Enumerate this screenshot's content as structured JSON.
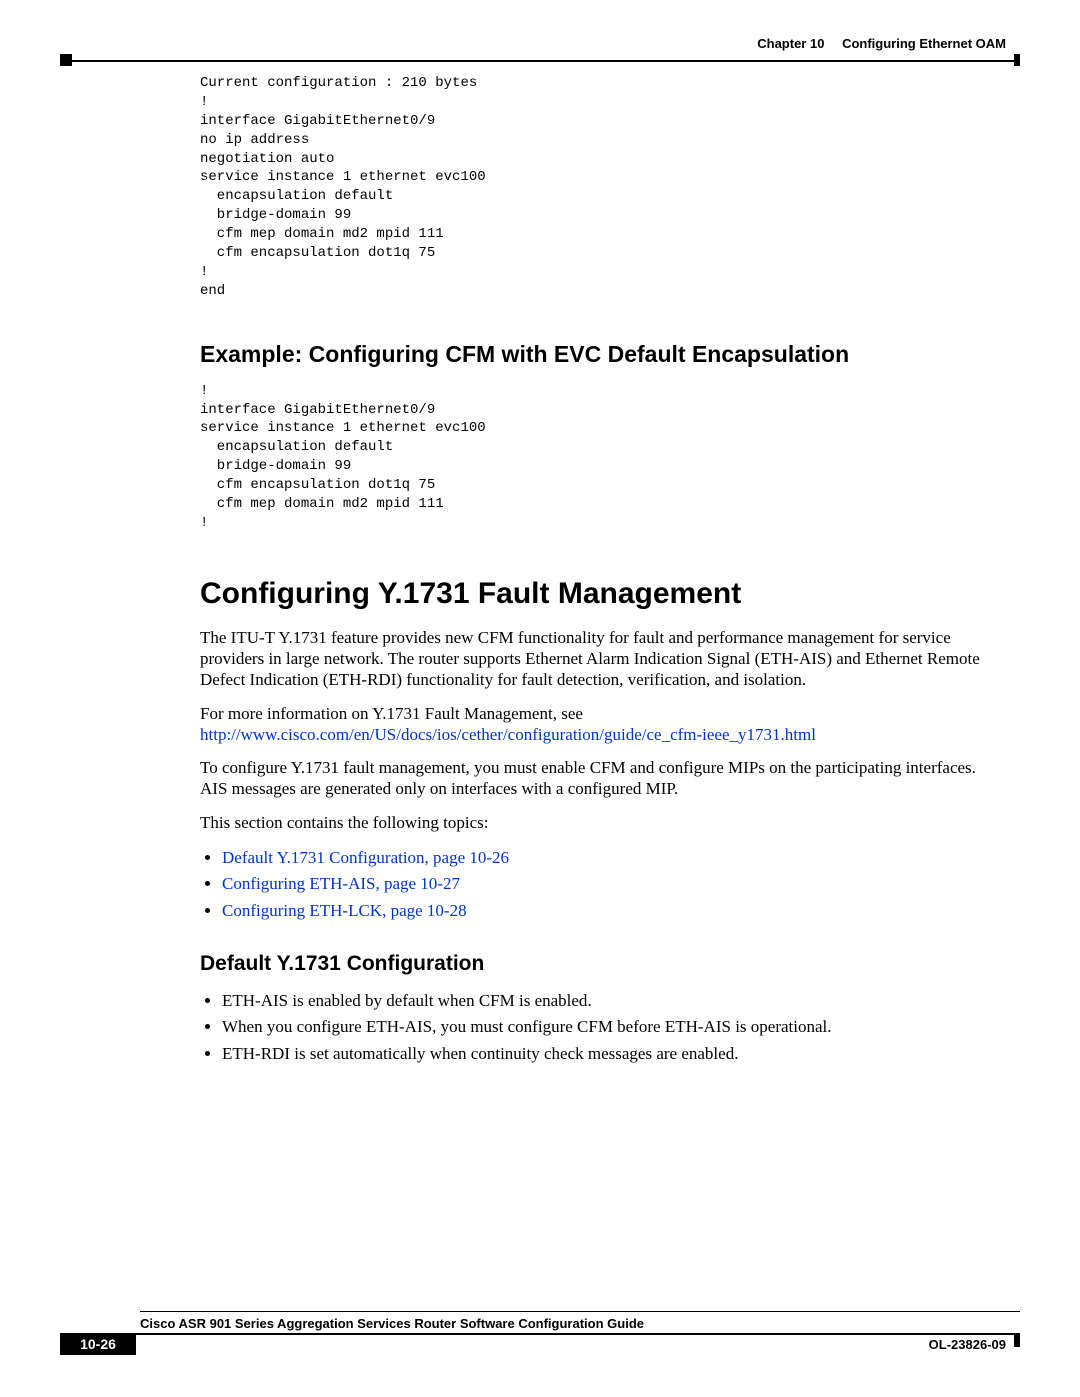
{
  "header": {
    "chapter": "Chapter 10",
    "title": "Configuring Ethernet OAM"
  },
  "code_block_1": "Current configuration : 210 bytes\n!\ninterface GigabitEthernet0/9\nno ip address\nnegotiation auto\nservice instance 1 ethernet evc100\n  encapsulation default\n  bridge-domain 99\n  cfm mep domain md2 mpid 111\n  cfm encapsulation dot1q 75\n!\nend",
  "section1_heading": "Example: Configuring CFM with EVC Default Encapsulation",
  "code_block_2": "!\ninterface GigabitEthernet0/9\nservice instance 1 ethernet evc100\n  encapsulation default\n  bridge-domain 99\n  cfm encapsulation dot1q 75\n  cfm mep domain md2 mpid 111\n!",
  "main_heading": "Configuring Y.1731 Fault Management",
  "para1": "The ITU-T Y.1731 feature provides new CFM functionality for fault and performance management for service providers in large network. The router supports Ethernet Alarm Indication Signal (ETH-AIS) and Ethernet Remote Defect Indication (ETH-RDI) functionality for fault detection, verification, and isolation.",
  "para2_lead": "For more information on Y.1731 Fault Management, see",
  "para2_link": "http://www.cisco.com/en/US/docs/ios/cether/configuration/guide/ce_cfm-ieee_y1731.html",
  "para3": "To configure Y.1731 fault management, you must enable CFM and configure MIPs on the participating interfaces. AIS messages are generated only on interfaces with a configured MIP.",
  "para4": "This section contains the following topics:",
  "topic_links": [
    "Default Y.1731 Configuration, page 10-26",
    "Configuring ETH-AIS, page 10-27",
    "Configuring ETH-LCK, page 10-28"
  ],
  "subsection_heading": "Default Y.1731 Configuration",
  "sub_bullets": [
    "ETH-AIS is enabled by default when CFM is enabled.",
    "When you configure ETH-AIS, you must configure CFM before ETH-AIS is operational.",
    "ETH-RDI is set automatically when continuity check messages are enabled."
  ],
  "footer": {
    "guide": "Cisco ASR 901 Series Aggregation Services Router Software Configuration Guide",
    "page": "10-26",
    "doc": "OL-23826-09"
  }
}
